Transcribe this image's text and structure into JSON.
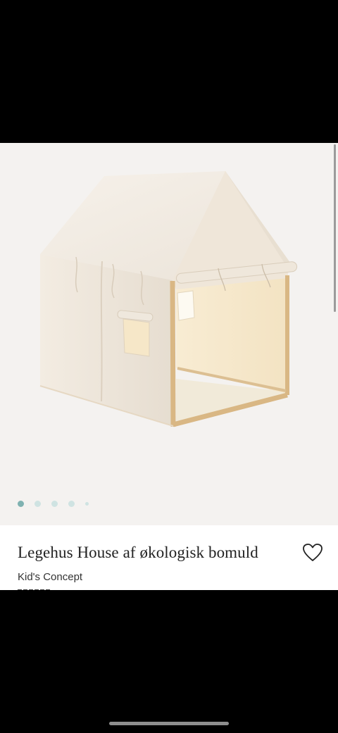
{
  "product": {
    "title": "Legehus House af økologisk bomuld",
    "brand": "Kid's Concept"
  },
  "gallery": {
    "image_count": 5,
    "active_index": 0
  },
  "icons": {
    "wishlist": "heart-outline-icon"
  },
  "colors": {
    "dot_active": "#7fb2b1",
    "dot_inactive": "#cfe3e2",
    "canvas": "#f4f2f0"
  }
}
